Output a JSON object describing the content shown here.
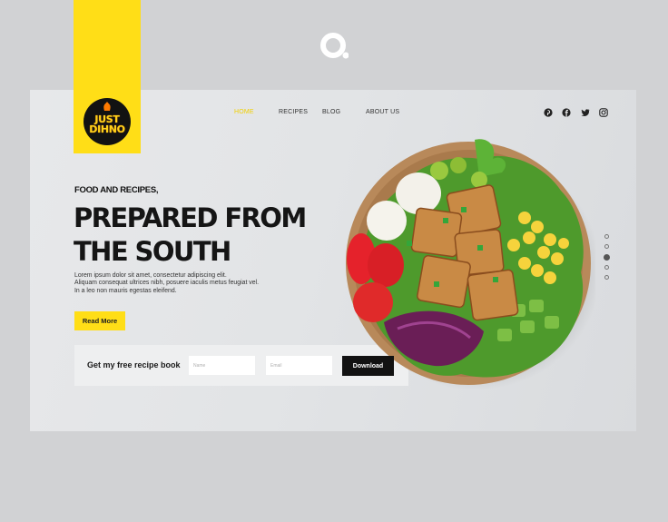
{
  "logo": {
    "line1": "JUST",
    "line2": "DIHNO"
  },
  "nav": {
    "items": [
      "HOME",
      "RECIPES",
      "BLOG",
      "ABOUT US"
    ],
    "active": "HOME"
  },
  "social": [
    "pinterest-icon",
    "facebook-icon",
    "twitter-icon",
    "instagram-icon"
  ],
  "hero": {
    "kicker": "FOOD AND RECIPES,",
    "headline_line1": "PREPARED FROM",
    "headline_line2": "THE SOUTH",
    "body_line1": "Lorem ipsum dolor sit amet, consectetur adipiscing elit.",
    "body_line2": "Aliquam consequat ultrices nibh, posuere iaculis metus feugiat vel.",
    "body_line3": "In a leo non mauris egestas eleifend.",
    "cta_label": "Read More"
  },
  "subscribe": {
    "label": "Get my free recipe book",
    "name_placeholder": "Name",
    "email_placeholder": "Email",
    "button_label": "Download"
  },
  "slider": {
    "count": 5,
    "active_index": 2
  },
  "colors": {
    "accent": "#ffde17",
    "dark": "#121212",
    "background": "#d1d2d4"
  }
}
